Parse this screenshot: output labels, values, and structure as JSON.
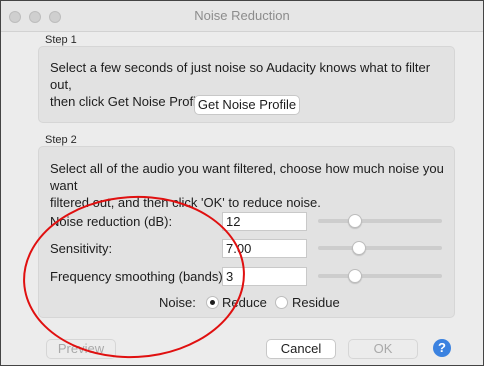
{
  "window": {
    "title": "Noise Reduction"
  },
  "step1": {
    "label": "Step 1",
    "description_line1": "Select a few seconds of just noise so Audacity knows what to filter out,",
    "description_line2": "then click Get Noise Profile:",
    "get_profile_button": "Get Noise Profile"
  },
  "step2": {
    "label": "Step 2",
    "description_line1": "Select all of the audio you want filtered, choose how much noise you want",
    "description_line2": "filtered out, and then click 'OK' to reduce noise.",
    "params": [
      {
        "label": "Noise reduction (dB):",
        "value": "12",
        "slider_fraction": 0.27
      },
      {
        "label": "Sensitivity:",
        "value": "7.00",
        "slider_fraction": 0.31
      },
      {
        "label": "Frequency smoothing (bands):",
        "value": "3",
        "slider_fraction": 0.27
      }
    ],
    "noise_label": "Noise:",
    "noise_options": [
      {
        "label": "Reduce",
        "selected": true
      },
      {
        "label": "Residue",
        "selected": false
      }
    ]
  },
  "footer": {
    "preview_button": "Preview",
    "cancel_button": "Cancel",
    "ok_button": "OK",
    "help_button": "?"
  },
  "colors": {
    "annotation": "#e01010",
    "help_button": "#3b82e0"
  }
}
